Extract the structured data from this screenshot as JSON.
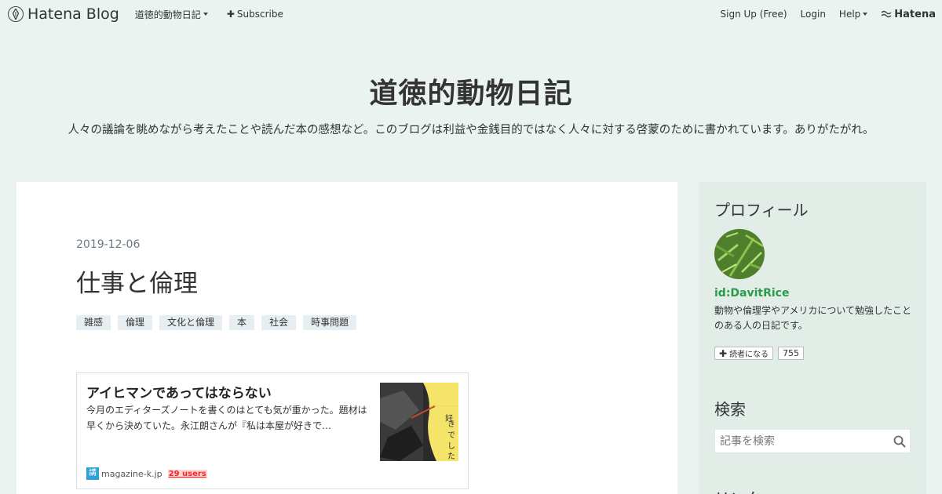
{
  "globalbar": {
    "logo_text": "Hatena Blog",
    "blog_menu_label": "道徳的動物日記",
    "subscribe_label": "Subscribe",
    "signup_label": "Sign Up (Free)",
    "login_label": "Login",
    "help_label": "Help",
    "brand_label": "Hatena"
  },
  "blog": {
    "title": "道徳的動物日記",
    "description": "人々の議論を眺めながら考えたことや読んだ本の感想など。このブログは利益や金銭目的ではなく人々に対する啓蒙のために書かれています。ありがたがれ。"
  },
  "entry": {
    "date": "2019-12-06",
    "title": "仕事と倫理",
    "tags": [
      "雑感",
      "倫理",
      "文化と倫理",
      "本",
      "社会",
      "時事問題"
    ],
    "embed": {
      "title": "アイヒマンであってはならない",
      "text": "今月のエディターズノートを書くのはとても気が重かった。題材は早くから決めていた。永江朗さんが『私は本屋が好きで…",
      "favicon_glyph": "講",
      "site": "magazine-k.jp",
      "users": "29 users"
    }
  },
  "sidebar": {
    "profile_heading": "プロフィール",
    "profile_id": "id:DavitRice",
    "profile_desc": "動物や倫理学やアメリカについて勉強したことのある人の日記です。",
    "reader_label": "読者になる",
    "reader_count": "755",
    "search_heading": "検索",
    "search_placeholder": "記事を検索",
    "next_heading": "リンク"
  },
  "colors": {
    "page_bg": "#eaf3ef",
    "sidebar_bg": "#e2ede8",
    "id_green": "#2a9a4b",
    "users_red": "#ff2222"
  }
}
